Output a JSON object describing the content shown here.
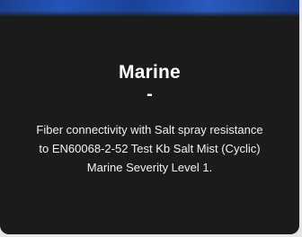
{
  "card": {
    "title": "Marine",
    "separator": "-",
    "description": "Fiber connectivity with Salt spray resistance to EN60068-2-52 Test Kb Salt Mist (Cyclic) Marine Severity Level 1."
  },
  "colors": {
    "card_background": "#1b1b1b",
    "page_background": "#e6e6e6",
    "image_accent": "#2454b8",
    "text": "#ffffff"
  }
}
